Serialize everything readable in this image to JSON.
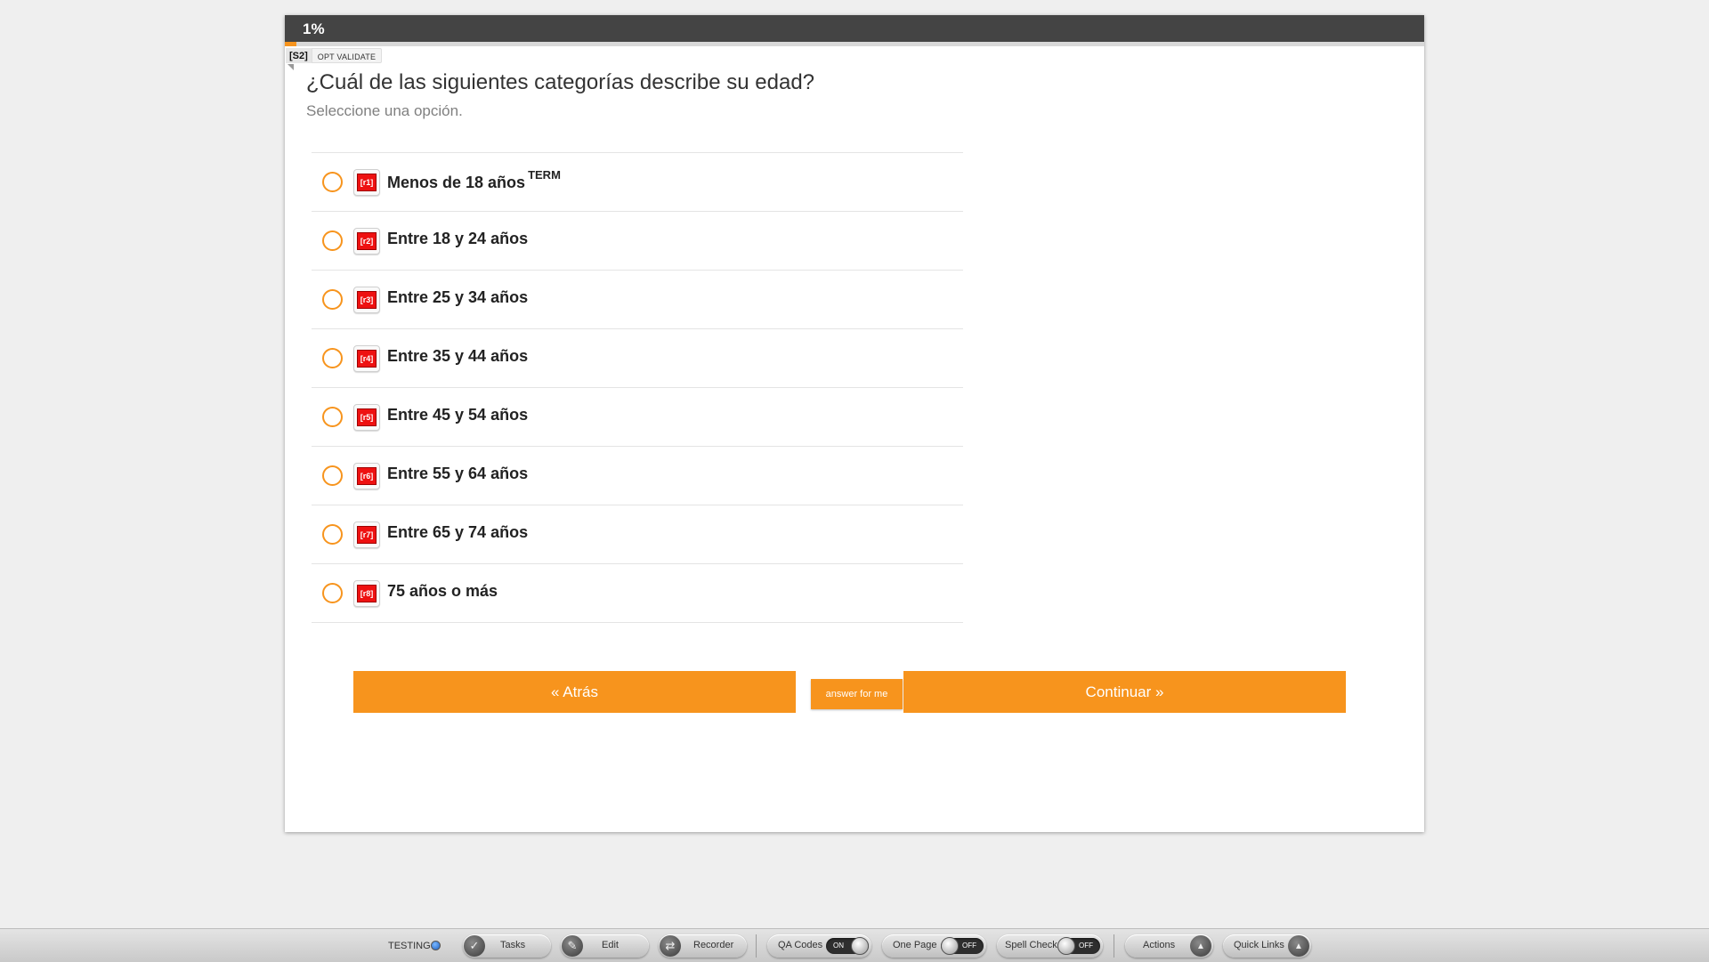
{
  "progress": {
    "text": "1%",
    "percent": 1
  },
  "qa": {
    "question_label": "[S2]",
    "validate_label": "OPT VALIDATE"
  },
  "question": {
    "title": "¿Cuál de las siguientes categorías describe su edad?",
    "instruction": "Seleccione una opción."
  },
  "answers": [
    {
      "code": "[r1]",
      "label": "Menos de 18 años",
      "tag": "TERM"
    },
    {
      "code": "[r2]",
      "label": "Entre 18 y 24 años"
    },
    {
      "code": "[r3]",
      "label": "Entre 25 y 34 años"
    },
    {
      "code": "[r4]",
      "label": "Entre 35 y 44 años"
    },
    {
      "code": "[r5]",
      "label": "Entre 45 y 54 años"
    },
    {
      "code": "[r6]",
      "label": "Entre 55 y 64 años"
    },
    {
      "code": "[r7]",
      "label": "Entre 65 y 74 años"
    },
    {
      "code": "[r8]",
      "label": "75 años o más"
    }
  ],
  "buttons": {
    "back": "« Atrás",
    "answer_for_me": "answer for me",
    "continue": "Continuar »"
  },
  "toolbar": {
    "testing": "TESTING",
    "tasks": "Tasks",
    "edit": "Edit",
    "recorder": "Recorder",
    "qa_codes": "QA Codes",
    "qa_codes_state": "ON",
    "one_page": "One Page",
    "one_page_state": "OFF",
    "spell_check": "Spell Check",
    "spell_check_state": "OFF",
    "actions": "Actions",
    "quick_links": "Quick Links"
  },
  "colors": {
    "accent": "#f7941d",
    "header": "#444444",
    "code_badge": "#ee1111"
  },
  "icons": {
    "tasks": "checkmark-icon",
    "edit": "pencil-icon",
    "recorder": "record-arrows-icon",
    "actions": "triangle-up-icon",
    "quick_links": "triangle-up-icon"
  }
}
